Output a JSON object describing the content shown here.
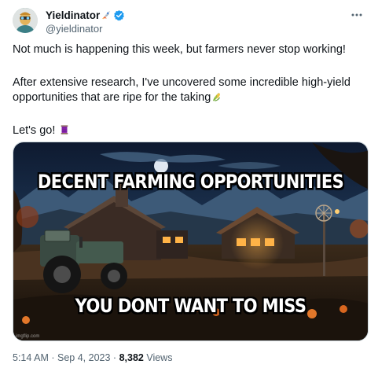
{
  "author": {
    "display_name": "Yieldinator",
    "handle": "@yieldinator",
    "name_emoji": "rocket-icon",
    "verified_icon": "verified-badge-icon",
    "verified_color": "#1d9bf0"
  },
  "more_icon": "more-horizontal-icon",
  "body": {
    "paragraph_1": "Not much is happening this week, but farmers never stop working!",
    "paragraph_2": "After extensive research, I've uncovered some incredible high-yield opportunities that are ripe for the taking",
    "paragraph_2_emoji": "corn-ear-icon",
    "paragraph_3": "Let's go!",
    "paragraph_3_emoji": "thread-spool-icon"
  },
  "media": {
    "caption_top": "DECENT FARMING OPPORTUNITIES",
    "caption_bottom": "YOU DONT WANT TO MISS",
    "watermark": "imgflip.com"
  },
  "meta": {
    "time": "5:14 AM",
    "separator": "·",
    "date": "Sep 4, 2023",
    "views_count": "8,382",
    "views_label": "Views"
  }
}
